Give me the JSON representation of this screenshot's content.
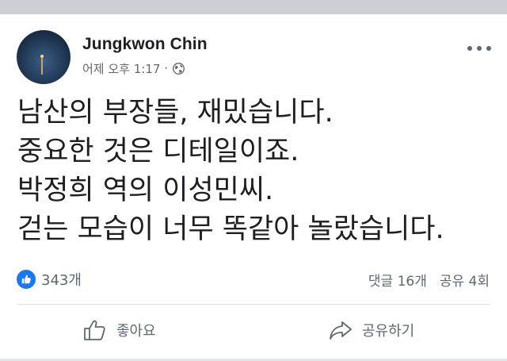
{
  "post": {
    "author": "Jungkwon Chin",
    "timestamp": "어제 오후 1:17",
    "separator": "·",
    "privacy_icon": "globe-icon",
    "menu_icon": "more-options-icon",
    "text_lines": [
      "남산의 부장들, 재밌습니다.",
      "중요한 것은 디테일이죠.",
      "박정희 역의 이성민씨.",
      "걷는 모습이 너무 똑같아 놀랐습니다."
    ]
  },
  "stats": {
    "reaction_icon": "like-badge-icon",
    "reaction_count": "343개",
    "comments": "댓글 16개",
    "shares": "공유 4회"
  },
  "actions": {
    "like_label": "좋아요",
    "share_label": "공유하기"
  },
  "colors": {
    "accent": "#1877f2",
    "text": "#1c1e21",
    "secondary_text": "#65676b",
    "divider": "#dadde1"
  }
}
